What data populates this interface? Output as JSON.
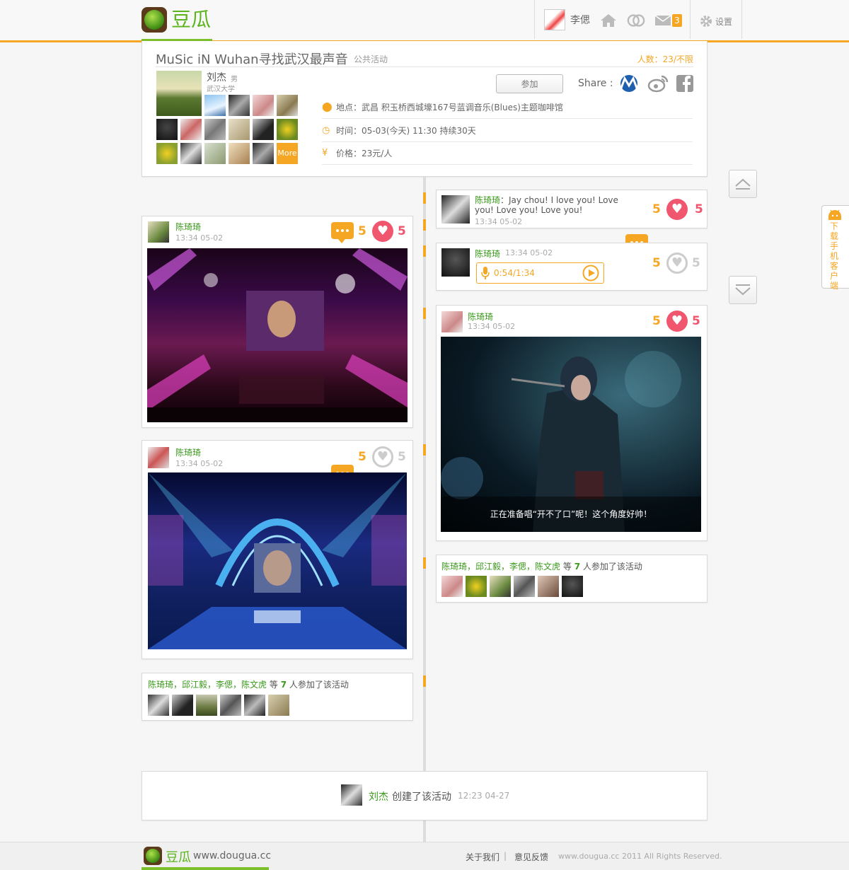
{
  "app": {
    "logo_text": "豆瓜",
    "brand_color": "#5bb41b",
    "accent_color": "#f5a623"
  },
  "topbar": {
    "user_name": "李偲",
    "mail_count": "3",
    "settings_label": "设置",
    "icons": [
      "home-icon",
      "friends-icon",
      "mail-icon",
      "gear-icon"
    ]
  },
  "event": {
    "title": "MuSic iN Wuhan寻找武汉最声音",
    "type": "公共活动",
    "count": "人数：23/不限",
    "host_name": "刘杰",
    "host_gender": "男",
    "host_school": "武汉大学",
    "more_label": "More",
    "join_label": "参加",
    "share_label": "Share :",
    "share_icons": [
      "renren-icon",
      "weibo-icon",
      "facebook-icon"
    ],
    "location": "地点：武昌 积玉桥西城壕167号蓝调音乐(Blues)主题咖啡馆",
    "time": "时间：05-03(今天) 11:30  持续30天",
    "price": "价格：23元/人"
  },
  "posts": {
    "left1": {
      "name": "陈琦琦",
      "time": "13:34 05-02",
      "comments": "5",
      "likes": "5"
    },
    "left2": {
      "name": "陈琦琦",
      "time": "13:34 05-02",
      "comments": "5",
      "likes": "5"
    },
    "left_join": {
      "names": "陈琦琦，邱江毅，李偲，陈文虎",
      "deng": "等",
      "count": "7",
      "suffix": "人参加了该活动"
    },
    "right1": {
      "name": "陈琦琦",
      "text": "：Jay chou! I love you! Love you! Love you! Love you!",
      "time": "13:34 05-02",
      "comments": "5",
      "likes": "5"
    },
    "right2": {
      "name": "陈琦琦",
      "time": "13:34 05-02",
      "audio": "0:54/1:34",
      "comments": "5",
      "likes": "5"
    },
    "right3": {
      "name": "陈琦琦",
      "time": "13:34 05-02",
      "caption": "正在准备唱“开不了口”呢！这个角度好帅！",
      "comments": "5",
      "likes": "5"
    },
    "right_join": {
      "names": "陈琦琦，邱江毅，李偲，陈文虎",
      "deng": "等",
      "count": "7",
      "suffix": "人参加了该活动"
    },
    "created": {
      "name": "刘杰",
      "text": "创建了该活动",
      "time": "12:23  04-27"
    }
  },
  "side": {
    "download_label": "下载手机客户端"
  },
  "footer": {
    "logo_text": "豆瓜",
    "site": "www.dougua.cc",
    "about": "关于我们",
    "sep": "|",
    "feedback": "意见反馈",
    "copyright": "www.dougua.cc 2011 All Rights Reserved."
  }
}
